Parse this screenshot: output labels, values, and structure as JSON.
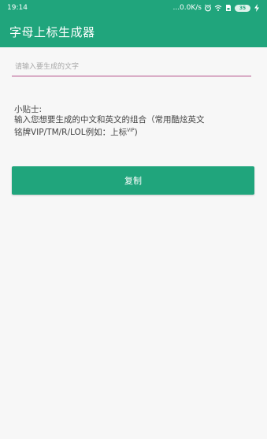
{
  "status_bar": {
    "time": "19:14",
    "network_speed": "...0.0K/s",
    "icons": [
      "alarm-icon",
      "wifi-icon",
      "sim-icon"
    ],
    "battery_level": "35"
  },
  "app_bar": {
    "title": "字母上标生成器"
  },
  "input": {
    "placeholder": "请输入要生成的文字",
    "value": ""
  },
  "tips": {
    "heading": "小贴士:",
    "line1": "输入您想要生成的中文和英文的组合（常用酷炫英文",
    "line2_prefix": "铭牌VIP/TM/R/LOL例如：上标",
    "line2_sup": "VIP",
    "line2_suffix": ")"
  },
  "copy_button": {
    "label": "复制"
  },
  "colors": {
    "primary": "#20a57c",
    "input_underline": "#b44f8a",
    "background": "#f7f7f7"
  }
}
